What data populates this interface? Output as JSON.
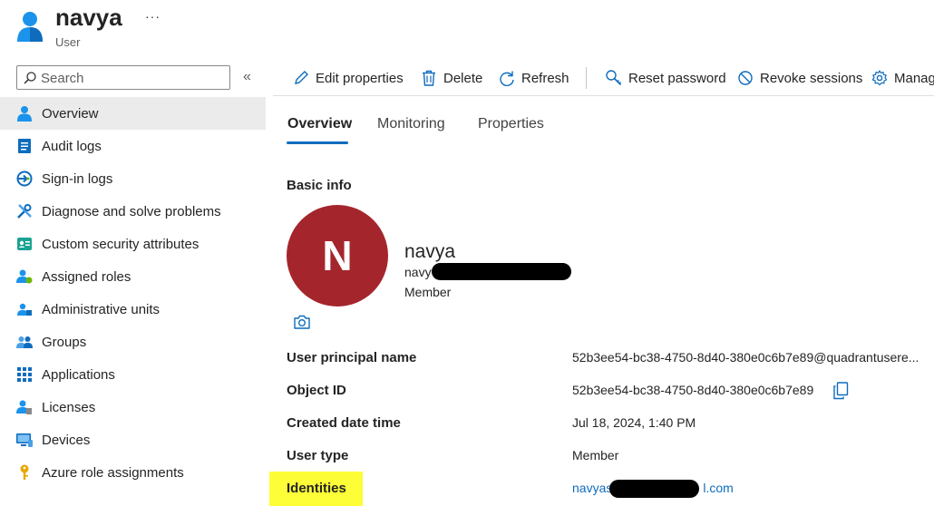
{
  "header": {
    "title": "navya",
    "subtitle": "User",
    "more": "···"
  },
  "search": {
    "placeholder": "Search",
    "collapse": "«"
  },
  "sidebar": {
    "items": [
      {
        "label": "Overview",
        "icon": "user-icon",
        "active": true
      },
      {
        "label": "Audit logs",
        "icon": "log-icon"
      },
      {
        "label": "Sign-in logs",
        "icon": "sign-in-icon"
      },
      {
        "label": "Diagnose and solve problems",
        "icon": "wrench-icon"
      },
      {
        "label": "Custom security attributes",
        "icon": "attributes-icon"
      },
      {
        "label": "Assigned roles",
        "icon": "roles-icon"
      },
      {
        "label": "Administrative units",
        "icon": "admin-units-icon"
      },
      {
        "label": "Groups",
        "icon": "groups-icon"
      },
      {
        "label": "Applications",
        "icon": "apps-grid-icon"
      },
      {
        "label": "Licenses",
        "icon": "license-icon"
      },
      {
        "label": "Devices",
        "icon": "device-icon"
      },
      {
        "label": "Azure role assignments",
        "icon": "key-icon"
      }
    ]
  },
  "toolbar": {
    "edit": "Edit properties",
    "delete": "Delete",
    "refresh": "Refresh",
    "reset_password": "Reset password",
    "revoke_sessions": "Revoke sessions",
    "manage": "Manag"
  },
  "tabs": [
    "Overview",
    "Monitoring",
    "Properties"
  ],
  "basic_info": {
    "section_title": "Basic info",
    "avatar_initial": "N",
    "avatar_color": "#a4262c",
    "name": "navya",
    "email_visible": "navy",
    "type": "Member"
  },
  "details": [
    {
      "label": "User principal name",
      "value": "52b3ee54-bc38-4750-8d40-380e0c6b7e89@quadrantusere..."
    },
    {
      "label": "Object ID",
      "value": "52b3ee54-bc38-4750-8d40-380e0c6b7e89"
    },
    {
      "label": "Created date time",
      "value": "Jul 18, 2024, 1:40 PM"
    },
    {
      "label": "User type",
      "value": "Member"
    },
    {
      "label": "Identities",
      "value_start": "navyas",
      "value_end": "l.com"
    }
  ],
  "colors": {
    "accent": "#0f6cbd",
    "highlight": "#fdfd38"
  }
}
